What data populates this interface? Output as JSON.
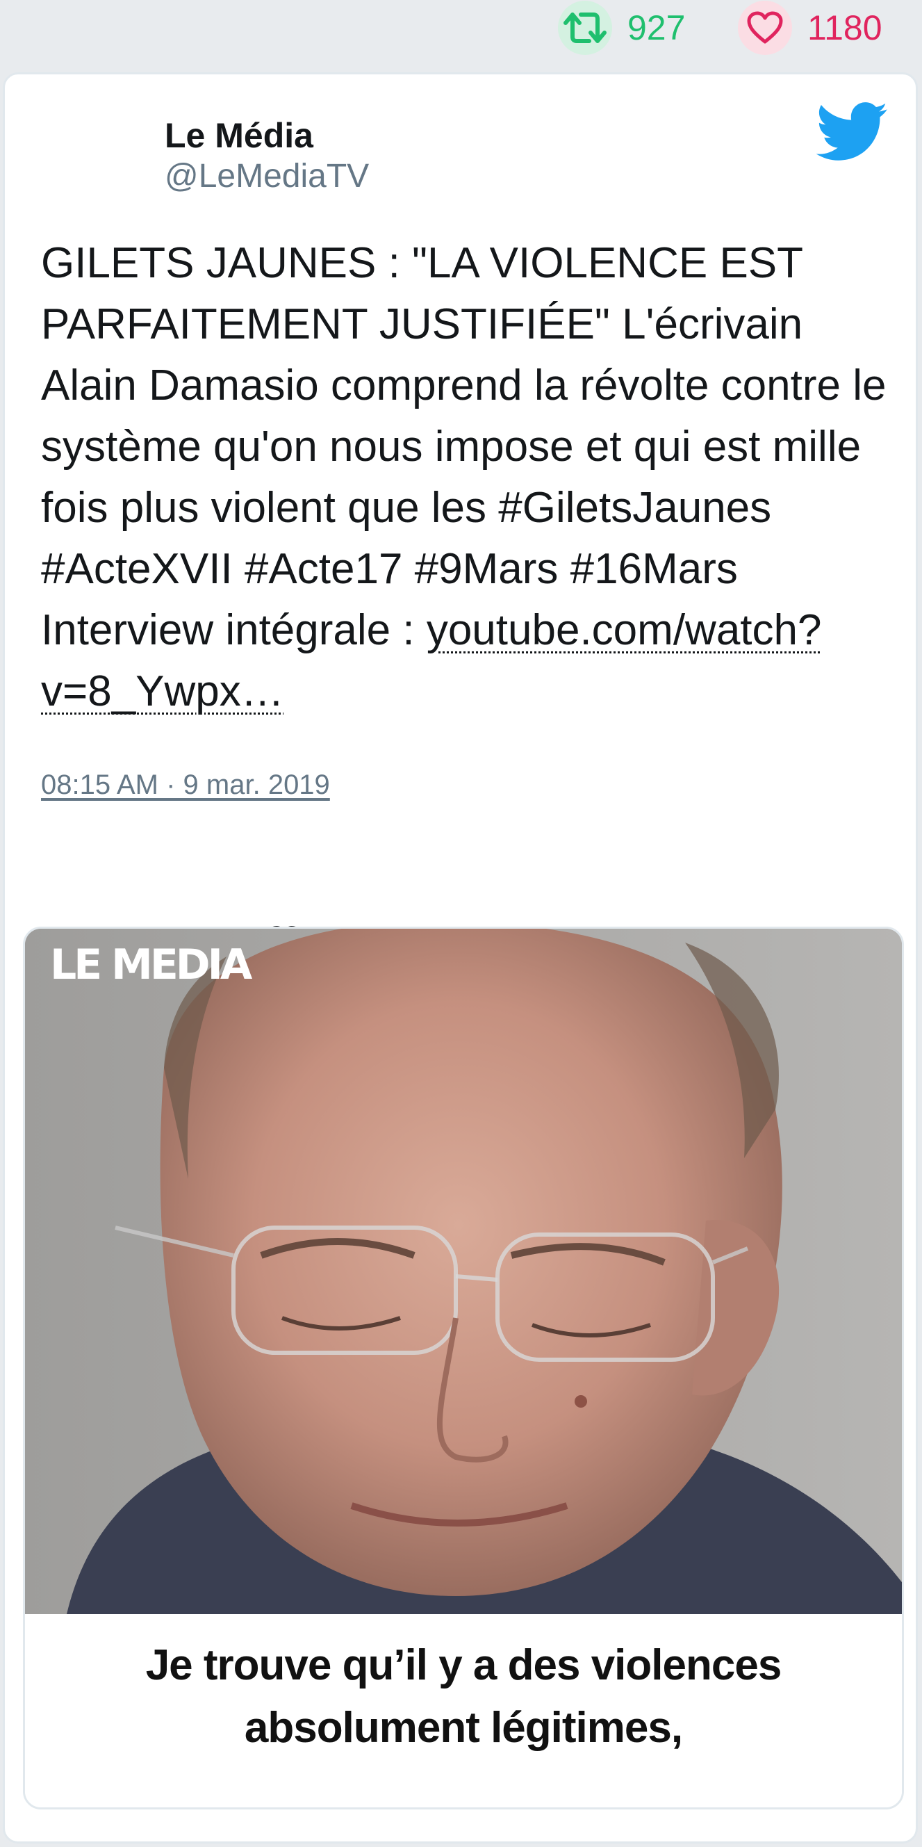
{
  "stats": {
    "retweets": "927",
    "likes": "1180"
  },
  "author": {
    "name": "Le Média",
    "handle": "@LeMediaTV"
  },
  "tweet": {
    "text": "GILETS JAUNES : \"LA VIOLENCE EST PARFAITEMENT JUSTIFIÉE\" L'écrivain Alain Damasio comprend la révolte contre le système qu'on nous impose et qui est mille fois plus violent que les #GiletsJaunes #ActeXVII #Acte17 #9Mars #16Mars Interview intégrale : ",
    "link": "youtube.com/watch?v=8_Ywpx…",
    "timestamp": "08:15 AM · 9 mar. 2019"
  },
  "media": {
    "logo": "LE MEDIA",
    "caption_line1": "Je trouve qu’il y a des violences",
    "caption_line2": "absolument légitimes,"
  },
  "icons": {
    "retweet": "retweet-icon",
    "like": "heart-icon",
    "brand": "twitter-bird-icon",
    "reply": "reply-icon"
  },
  "colors": {
    "retweet": "#1fbf6e",
    "like": "#e0245e",
    "twitter_blue": "#1da1f2",
    "text": "#14171a",
    "muted": "#657786"
  }
}
